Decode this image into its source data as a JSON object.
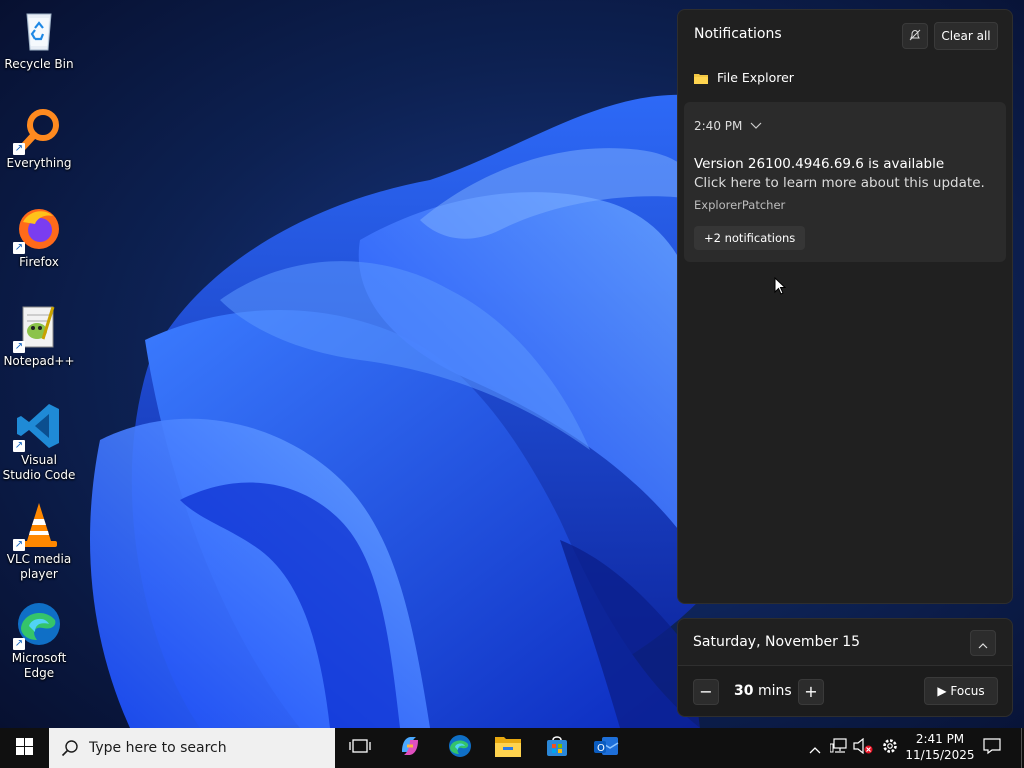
{
  "desktop": {
    "icons": [
      {
        "label": "Recycle Bin"
      },
      {
        "label": "Everything"
      },
      {
        "label": "Firefox"
      },
      {
        "label": "Notepad++"
      },
      {
        "label": "Visual Studio Code"
      },
      {
        "label": "VLC media player"
      },
      {
        "label": "Microsoft Edge"
      }
    ]
  },
  "notifications": {
    "title": "Notifications",
    "clear_all": "Clear all",
    "app_name": "File Explorer",
    "card": {
      "time": "2:40 PM",
      "title": "Version 26100.4946.69.6 is available",
      "body": "Click here to learn more about this update.",
      "source": "ExplorerPatcher",
      "more": "+2 notifications"
    }
  },
  "calendar": {
    "date": "Saturday, November 15",
    "focus_minutes": "30",
    "mins_label": "mins",
    "focus_label": "Focus"
  },
  "taskbar": {
    "search_placeholder": "Type here to search",
    "time": "2:41 PM",
    "date": "11/15/2025"
  },
  "colors": {
    "accent": "#0078d4",
    "panel_bg": "#202020",
    "card_bg": "#2b2b2b",
    "taskbar_bg": "#101010"
  }
}
